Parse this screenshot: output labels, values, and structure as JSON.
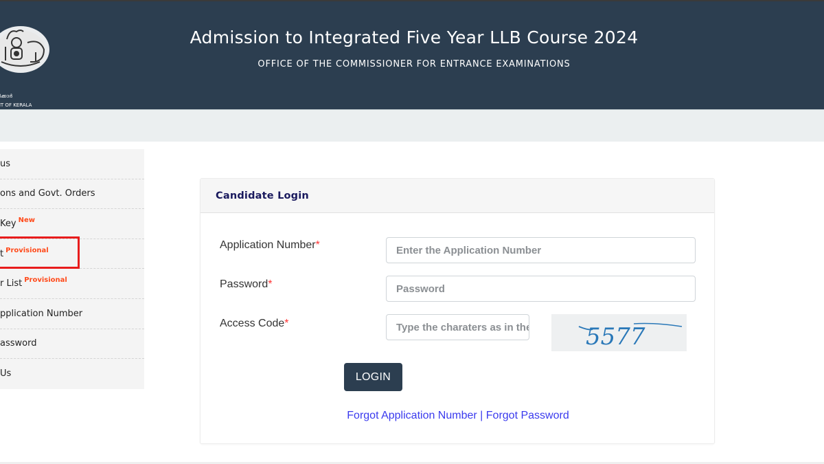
{
  "header": {
    "title": "Admission to Integrated Five Year LLB Course 2024",
    "subtitle": "OFFICE OF THE COMMISSIONER FOR ENTRANCE EXAMINATIONS",
    "logo_text_malayalam": "കേരള സർക്കാർ",
    "logo_text_english": "GOVERNMENT OF KERALA",
    "logo_text_malayalam_visible": "ള സർക്കാർ",
    "logo_text_english_visible": "NMENT OF KERALA",
    "logo_icon": "kerala-emblem-icon"
  },
  "sidebar": {
    "items": [
      {
        "label": "us",
        "badge": ""
      },
      {
        "label": "ons and Govt. Orders",
        "badge": ""
      },
      {
        "label": "Key",
        "badge": "New"
      },
      {
        "label": "t",
        "badge": "Provisional"
      },
      {
        "label": "r List",
        "badge": "Provisional"
      },
      {
        "label": "pplication Number",
        "badge": ""
      },
      {
        "label": "assword",
        "badge": ""
      },
      {
        "label": "Us",
        "badge": ""
      }
    ],
    "highlighted_index": 3
  },
  "login": {
    "heading": "Candidate Login",
    "fields": [
      {
        "label": "Application Number",
        "required": "*",
        "placeholder": "Enter the Application Number",
        "value": ""
      },
      {
        "label": "Password",
        "required": "*",
        "placeholder": "Password",
        "value": ""
      },
      {
        "label": "Access Code",
        "required": "*",
        "placeholder": "Type the charaters as in the image",
        "value": ""
      }
    ],
    "captcha_text": "5577",
    "login_button": "LOGIN",
    "forgot_app_link": "Forgot Application Number",
    "separator": "|",
    "forgot_password_link": "Forgot Password"
  },
  "colors": {
    "header_bg": "#2c3e50",
    "band_bg": "#ebeff0",
    "badge": "#ff4a1a",
    "highlight_border": "#e81c1c",
    "link": "#3a3aee",
    "heading": "#1a1a5e",
    "required": "#ff3333"
  }
}
